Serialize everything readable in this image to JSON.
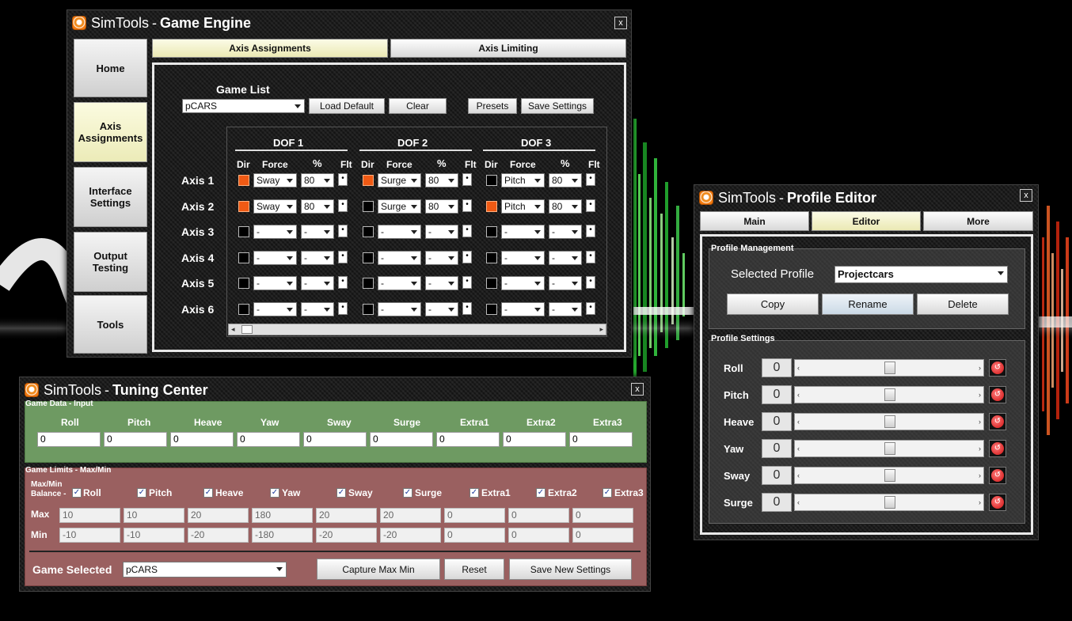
{
  "game_engine": {
    "title_a": "SimTools",
    "title_b": " - ",
    "title_c": "Game Engine",
    "close": "x",
    "sidebar": [
      "Home",
      "Axis Assignments",
      "Interface Settings",
      "Output Testing",
      "Tools"
    ],
    "tabs": [
      "Axis Assignments",
      "Axis Limiting"
    ],
    "game_list_label": "Game List",
    "game_selected": "pCARS",
    "buttons": {
      "load_default": "Load Default",
      "clear": "Clear",
      "presets": "Presets",
      "save_settings": "Save Settings"
    },
    "dof_headers": [
      "DOF 1",
      "DOF 2",
      "DOF 3"
    ],
    "col_headers": {
      "dir": "Dir",
      "force": "Force",
      "pct": "%",
      "flt": "Flt"
    },
    "axes": [
      {
        "label": "Axis 1",
        "dofs": [
          {
            "dir": true,
            "force": "Sway",
            "pct": "80"
          },
          {
            "dir": true,
            "force": "Surge",
            "pct": "80"
          },
          {
            "dir": false,
            "force": "Pitch",
            "pct": "80"
          }
        ]
      },
      {
        "label": "Axis 2",
        "dofs": [
          {
            "dir": true,
            "force": "Sway",
            "pct": "80"
          },
          {
            "dir": false,
            "force": "Surge",
            "pct": "80"
          },
          {
            "dir": true,
            "force": "Pitch",
            "pct": "80"
          }
        ]
      },
      {
        "label": "Axis 3",
        "dofs": [
          {
            "dir": false,
            "force": "-",
            "pct": "-"
          },
          {
            "dir": false,
            "force": "-",
            "pct": "-"
          },
          {
            "dir": false,
            "force": "-",
            "pct": "-"
          }
        ]
      },
      {
        "label": "Axis 4",
        "dofs": [
          {
            "dir": false,
            "force": "-",
            "pct": "-"
          },
          {
            "dir": false,
            "force": "-",
            "pct": "-"
          },
          {
            "dir": false,
            "force": "-",
            "pct": "-"
          }
        ]
      },
      {
        "label": "Axis 5",
        "dofs": [
          {
            "dir": false,
            "force": "-",
            "pct": "-"
          },
          {
            "dir": false,
            "force": "-",
            "pct": "-"
          },
          {
            "dir": false,
            "force": "-",
            "pct": "-"
          }
        ]
      },
      {
        "label": "Axis 6",
        "dofs": [
          {
            "dir": false,
            "force": "-",
            "pct": "-"
          },
          {
            "dir": false,
            "force": "-",
            "pct": "-"
          },
          {
            "dir": false,
            "force": "-",
            "pct": "-"
          }
        ]
      }
    ],
    "flt_glyph": "•"
  },
  "tuning": {
    "title_a": "SimTools",
    "title_b": " - ",
    "title_c": "Tuning Center",
    "close": "x",
    "input_section": "Game Data - Input",
    "channels": [
      "Roll",
      "Pitch",
      "Heave",
      "Yaw",
      "Sway",
      "Surge",
      "Extra1",
      "Extra2",
      "Extra3"
    ],
    "inputs": [
      "0",
      "0",
      "0",
      "0",
      "0",
      "0",
      "0",
      "0",
      "0"
    ],
    "limits_section": "Game Limits - Max/Min",
    "balance_label_1": "Max/Min",
    "balance_label_2": "Balance -",
    "max_label": "Max",
    "min_label": "Min",
    "max_values": [
      "10",
      "10",
      "20",
      "180",
      "20",
      "20",
      "0",
      "0",
      "0"
    ],
    "min_values": [
      "-10",
      "-10",
      "-20",
      "-180",
      "-20",
      "-20",
      "0",
      "0",
      "0"
    ],
    "check_glyph": "✓",
    "game_selected_label": "Game Selected",
    "game_selected": "pCARS",
    "buttons": {
      "capture": "Capture Max Min",
      "reset": "Reset",
      "save_new": "Save New Settings"
    }
  },
  "profile": {
    "title_a": "SimTools",
    "title_b": " - ",
    "title_c": "Profile Editor",
    "close": "x",
    "tabs": [
      "Main",
      "Editor",
      "More"
    ],
    "management_label": "Profile Management",
    "selected_profile_label": "Selected Profile",
    "selected_profile": "Projectcars",
    "buttons": {
      "copy": "Copy",
      "rename": "Rename",
      "delete": "Delete"
    },
    "settings_label": "Profile Settings",
    "settings": [
      {
        "name": "Roll",
        "value": "0"
      },
      {
        "name": "Pitch",
        "value": "0"
      },
      {
        "name": "Heave",
        "value": "0"
      },
      {
        "name": "Yaw",
        "value": "0"
      },
      {
        "name": "Sway",
        "value": "0"
      },
      {
        "name": "Surge",
        "value": "0"
      }
    ],
    "reset_glyph": "↺"
  },
  "colors": {
    "accent_orange": "#f05a14",
    "tab_active": "#ecebb8",
    "input_panel": "#6e9a62",
    "limits_panel": "#9a6060"
  }
}
